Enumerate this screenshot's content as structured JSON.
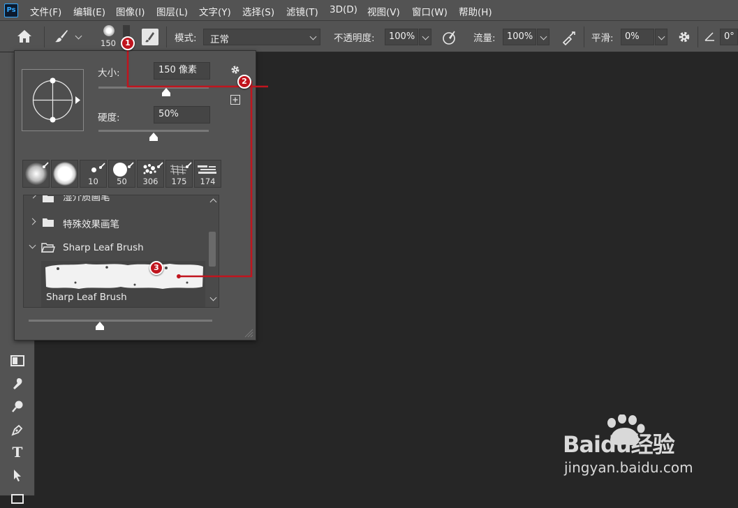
{
  "app": {
    "logo_text": "Ps"
  },
  "menu": [
    "文件(F)",
    "编辑(E)",
    "图像(I)",
    "图层(L)",
    "文字(Y)",
    "选择(S)",
    "滤镜(T)",
    "3D(D)",
    "视图(V)",
    "窗口(W)",
    "帮助(H)"
  ],
  "options": {
    "brush_size": "150",
    "mode_label": "模式:",
    "mode_value": "正常",
    "opacity_label": "不透明度:",
    "opacity_value": "100%",
    "flow_label": "流量:",
    "flow_value": "100%",
    "smoothing_label": "平滑:",
    "smoothing_value": "0%",
    "angle_value": "0°"
  },
  "popup": {
    "size_label": "大小:",
    "size_value": "150 像素",
    "hardness_label": "硬度:",
    "hardness_value": "50%",
    "presets": [
      {
        "num": ""
      },
      {
        "num": ""
      },
      {
        "num": "10"
      },
      {
        "num": "50"
      },
      {
        "num": "306"
      },
      {
        "num": "175"
      },
      {
        "num": "174"
      }
    ],
    "folders": [
      {
        "label": "湿介质画笔",
        "expanded": false
      },
      {
        "label": "特殊效果画笔",
        "expanded": false
      },
      {
        "label": "Sharp Leaf Brush",
        "expanded": true
      }
    ],
    "brush_item_label": "Sharp Leaf Brush"
  },
  "annotations": {
    "badges": [
      "1",
      "2",
      "3"
    ],
    "color": "#c0151e"
  },
  "watermark": {
    "logo": "Baidu经验",
    "url": "jingyan.baidu.com"
  }
}
